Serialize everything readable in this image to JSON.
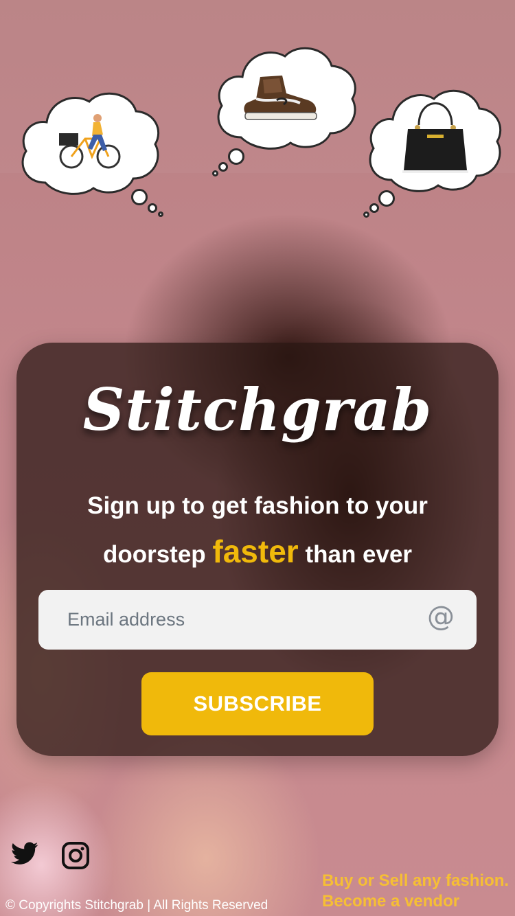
{
  "brand": {
    "name": "Stitchgrab"
  },
  "hero": {
    "tagline_part1": "Sign up to get fashion to your doorstep",
    "tagline_accent": "faster",
    "tagline_part2": "than ever"
  },
  "form": {
    "email_placeholder": "Email address",
    "email_value": "",
    "subscribe_label": "SUBSCRIBE"
  },
  "thoughts": [
    {
      "icon": "delivery-bicycle-icon"
    },
    {
      "icon": "sneaker-icon"
    },
    {
      "icon": "handbag-icon"
    }
  ],
  "social": {
    "twitter_icon": "twitter-icon",
    "instagram_icon": "instagram-icon"
  },
  "footer": {
    "copyright": "© Copyrights Stitchgrab | All Rights Reserved",
    "vendor_line1": "Buy or Sell any fashion.",
    "vendor_line2": "Become a vendor"
  },
  "colors": {
    "accent": "#f0b90b",
    "vendor_text": "#f6bf34",
    "card_bg": "rgba(40,22,18,0.72)"
  }
}
